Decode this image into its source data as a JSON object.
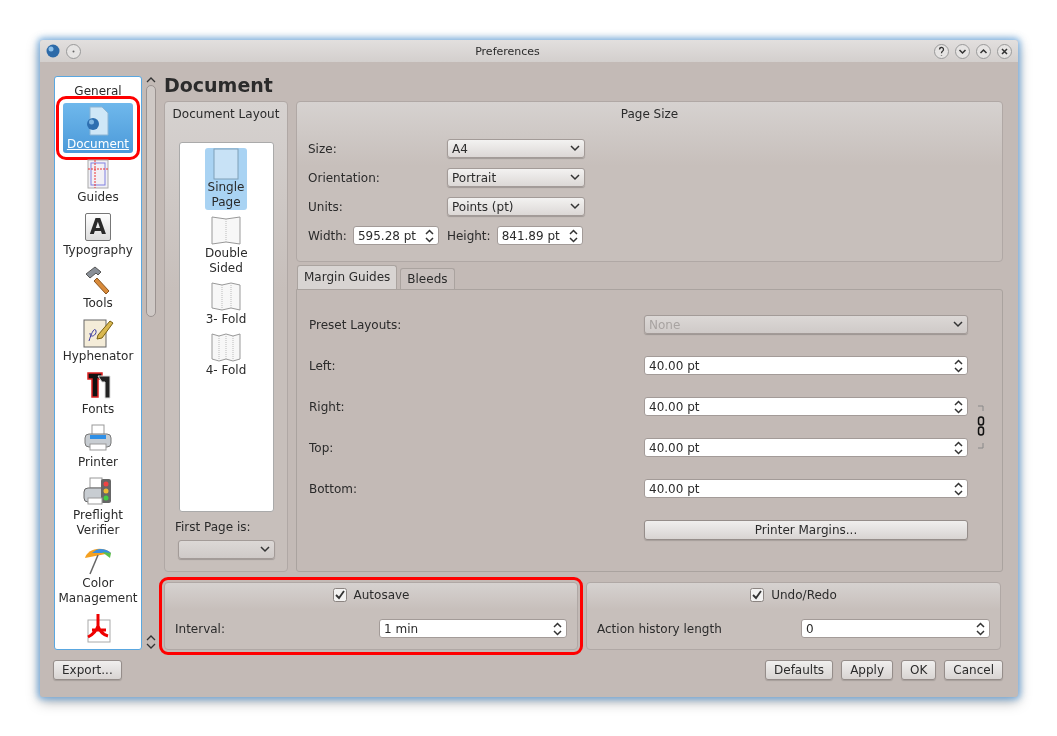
{
  "window": {
    "title": "Preferences"
  },
  "sidebar": {
    "items": [
      {
        "label": "General",
        "selected": false,
        "highlighted": false
      },
      {
        "label": "Document",
        "kind": "document",
        "selected": true,
        "highlighted": true
      },
      {
        "label": "Guides",
        "kind": "guides",
        "selected": false,
        "highlighted": false
      },
      {
        "label": "Typography",
        "kind": "typography",
        "glyph": "A",
        "selected": false,
        "highlighted": false
      },
      {
        "label": "Tools",
        "kind": "hammer",
        "selected": false,
        "highlighted": false
      },
      {
        "label": "Hyphenator",
        "kind": "pen",
        "selected": false,
        "highlighted": false
      },
      {
        "label": "Fonts",
        "kind": "fonts",
        "selected": false,
        "highlighted": false
      },
      {
        "label": "Printer",
        "kind": "printer",
        "selected": false,
        "highlighted": false
      },
      {
        "label": "Preflight Verifier",
        "kind": "preflight",
        "selected": false,
        "highlighted": false
      },
      {
        "label": "Color Management",
        "kind": "umbrella",
        "selected": false,
        "highlighted": false
      },
      {
        "kind": "pdf",
        "selected": false,
        "highlighted": false
      }
    ]
  },
  "page": {
    "heading": "Document"
  },
  "document_layout": {
    "title": "Document Layout",
    "layouts": [
      {
        "label": "Single Page",
        "kind": "single",
        "selected": true
      },
      {
        "label": "Double Sided",
        "kind": "double",
        "selected": false
      },
      {
        "label": "3- Fold",
        "kind": "three",
        "selected": false
      },
      {
        "label": "4- Fold",
        "kind": "four",
        "selected": false
      }
    ],
    "first_page_label": "First Page is:"
  },
  "page_size": {
    "title": "Page Size",
    "fields": [
      {
        "label": "Size:",
        "value": "A4"
      },
      {
        "label": "Orientation:",
        "value": "Portrait"
      },
      {
        "label": "Units:",
        "value": "Points (pt)"
      }
    ],
    "width": {
      "label": "Width:",
      "value": "595.28 pt"
    },
    "height": {
      "label": "Height:",
      "value": "841.89 pt"
    }
  },
  "tabs": [
    {
      "label": "Margin Guides",
      "selected": true
    },
    {
      "label": "Bleeds",
      "selected": false
    }
  ],
  "margins": {
    "preset": {
      "label": "Preset Layouts:",
      "value": "None",
      "disabled": true
    },
    "fields": [
      {
        "label": "Left:",
        "value": "40.00 pt"
      },
      {
        "label": "Right:",
        "value": "40.00 pt"
      },
      {
        "label": "Top:",
        "value": "40.00 pt"
      },
      {
        "label": "Bottom:",
        "value": "40.00 pt"
      }
    ],
    "printer_margins_button": "Printer Margins..."
  },
  "autosave": {
    "label": "Autosave",
    "checked": true,
    "highlighted": true,
    "field_label": "Interval:",
    "value": "1 min"
  },
  "undo": {
    "label": "Undo/Redo",
    "checked": true,
    "field_label": "Action history length",
    "value": "0"
  },
  "buttons": {
    "export": "Export...",
    "actions": [
      "Defaults",
      "Apply",
      "OK",
      "Cancel"
    ]
  }
}
